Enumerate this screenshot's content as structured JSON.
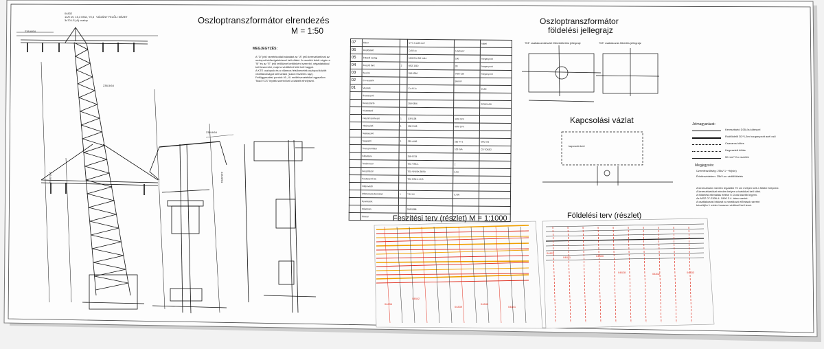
{
  "sheet": {
    "title_block_lines": [
      "04832",
      "14/0 kV, 15,3 MVA, Y0,5",
      "3x70 LS (A) oszlop",
      "VÁGÁNY FELŐLI NÉZET"
    ],
    "main_title": "Oszloptranszformátor elrendezés",
    "main_scale": "M = 1:50",
    "notes_heading": "MEGJEGYZÉS:",
    "notes": [
      "A \"D\" jelű vezetékoldali rakatást az \"A\" jelű kereszttartóval az",
      "oszlopot tetőszigeteléssel kell ellátni. A vezeték felett végén a",
      "\"B\" és az \"E\" jelű tetőlözvé kettőnként szerelni, végadatokkal",
      "kell leszerelni, majd a védőtétet felül kell hagyni.",
      "A KTE oszlopok és a villamos felsővezeték oszlopai között",
      "védőtávolságot kell tartani (Lásd részletes rajz).",
      "Felfüggesztési pontok: fő-, ill. mellékvezetékkel egyezően",
      "\"lásd TCS\" lépték szerint kell a kábelt elhelyezni."
    ],
    "grounding_title_1": "Oszloptranszformátor",
    "grounding_title_2": "földelési jellegrajz",
    "grounding_sub_left": "\"E3\" csatlakozókészlet fölbeköttetési jellegrajz",
    "grounding_sub_right": "\"D3\" csatlakozás földelés jellegrajz",
    "switch_title": "Kapcsolási vázlat",
    "switch_label": "kapcsoló kert",
    "tension_title": "Feszítési terv (részlet) M = 1:1000",
    "earthing_title": "Földelési terv (részlet)"
  },
  "legend": {
    "heading": "Jelmagyarázat:",
    "items": [
      "Kereszttartó D35-ös kötésvel",
      "Rúdföldelő D2*1,5m horganyzott acél cső",
      "Csavaros kötés",
      "Hegesztett kötés",
      "50 mm² Cu vezeték"
    ],
    "notes_heading": "Megjegyzés:",
    "notes": [
      "Üzemfeszültség: 25kV   1~+hl(sin)",
      "Érintésvédelem: 25kV-on védőföldelés",
      "A kereszttartó mentén legalább 70 cm mélyen kell a földbe helyezni.",
      "A kereszttartókat minden helyen a tartókkal kell kötni.",
      "A földelési ellenállás értéke 5 Ω-nál kisebb legyen.",
      "Az MSZ 07-2306-4: 1990 3.4. ábra szerint.",
      "A csatlakozási hálózat a vonatkozó előírások szerint",
      "készüljön 1 méter hosszon védőcső kell tenni."
    ]
  },
  "table": {
    "rows": [
      [
        "07",
        "kábel",
        "",
        "NYY-J 4x35 mm²",
        "",
        "kábel"
      ],
      [
        "06",
        "Rúdföldelő",
        "",
        "Cu50 4x",
        "1x50mm²",
        "",
        ""
      ],
      [
        "05",
        "Földelő szalag",
        "",
        "MSZ EN ISO 1461",
        "100",
        "horganyzott"
      ],
      [
        "04",
        "Feszítő lánc",
        "2",
        "MSZ 1610",
        "28",
        "horganyzott"
      ],
      [
        "03",
        "Szorító",
        "",
        "258-5356",
        "VGD-125",
        "horganyzott"
      ],
      [
        "02",
        "Cu vezeték",
        "",
        "",
        "50mm²",
        ""
      ],
      [
        "01",
        "Vezeték",
        "",
        "Cu-Al 1x",
        "",
        "Cu50"
      ],
      [
        "",
        "Szakaszoló",
        "",
        "",
        "",
        ""
      ],
      [
        "",
        "Kereszttartó",
        "",
        "258-5306",
        "",
        "SCHRACK"
      ],
      [
        "",
        "Rúdföldelő",
        "",
        "",
        "",
        ""
      ],
      [
        "",
        "Feszítő szerkezet",
        "1",
        "D3-5138",
        "KPM 1Ph"
      ],
      [
        "",
        "Villámvédő",
        "1",
        "258-5128",
        "KPM 1Ph"
      ],
      [
        "",
        "Szakaszoló",
        "",
        "",
        "",
        ""
      ],
      [
        "",
        "Szigetelő",
        "1",
        "235-4499",
        "235 -H-1",
        "KPM VS"
      ],
      [
        "",
        "Transzformátor",
        "",
        "",
        "100 kVA",
        "CS-TOKE2"
      ],
      [
        "",
        "Kábelsaru",
        "",
        "258-5733",
        "",
        ""
      ],
      [
        "",
        "Tartókonzol",
        "",
        "TEL-VSK-1",
        "2",
        ""
      ],
      [
        "",
        "Feszítőszál",
        "",
        "TEL-VIVISK-30/50",
        "6,3A",
        ""
      ],
      [
        "",
        "Szakaszoló alj",
        "",
        "TEL-ESZ-1-10,5",
        "",
        ""
      ],
      [
        "",
        "Villámvédő",
        "",
        "",
        "",
        ""
      ],
      [
        "",
        "OSO (transzformátor)",
        "1",
        "T 12 kV",
        "5,795"
      ],
      [
        "",
        "Nyomtatott",
        "",
        "",
        "",
        ""
      ],
      [
        "",
        "Kábelsaru",
        "",
        "258-5388",
        "",
        ""
      ],
      [
        "",
        "Csavar",
        "",
        "",
        "",
        ""
      ]
    ]
  },
  "labels": {
    "dim_top": "238-6/64",
    "dim_side_1": "238-5/64",
    "dim_side_2": "249-5/64",
    "dim_side_3": "245-5/64",
    "dim_mid": "238-6/64",
    "map_codes": [
      "04829",
      "04831",
      "04830",
      "04828",
      "04832",
      "04833",
      "04839",
      "04840",
      "04841",
      "04842",
      "04834"
    ]
  },
  "colors": {
    "line": "#111111",
    "red": "#e03020",
    "orange": "#f0a000",
    "background": "#fdfdfd",
    "shadow": "#d4d4d4"
  }
}
